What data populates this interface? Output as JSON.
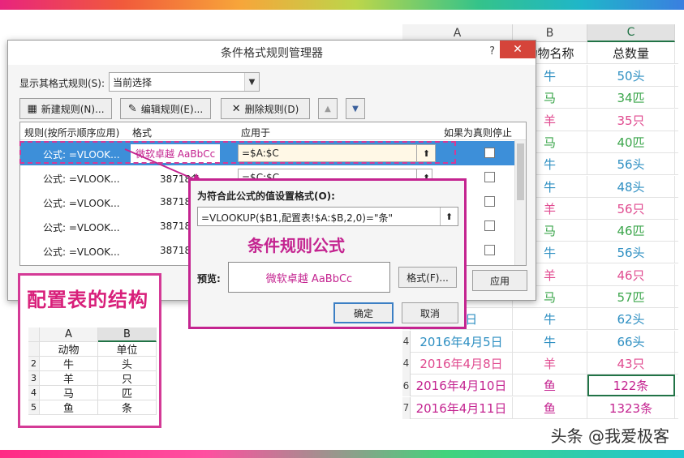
{
  "sheet": {
    "col_heads": [
      "A",
      "B",
      "C"
    ],
    "header_row": {
      "b": "动物名称",
      "c": "总数量"
    },
    "rows": [
      {
        "num": "",
        "date": "",
        "animal": "牛",
        "qty": "50头",
        "color": "#2e8fc2"
      },
      {
        "num": "",
        "date": "",
        "animal": "马",
        "qty": "34匹",
        "color": "#3aa54a"
      },
      {
        "num": "",
        "date": "",
        "animal": "羊",
        "qty": "35只",
        "color": "#e04a8f"
      },
      {
        "num": "",
        "date": "",
        "animal": "马",
        "qty": "40匹",
        "color": "#3aa54a"
      },
      {
        "num": "",
        "date": "",
        "animal": "牛",
        "qty": "56头",
        "color": "#2e8fc2"
      },
      {
        "num": "",
        "date": "",
        "animal": "牛",
        "qty": "48头",
        "color": "#2e8fc2"
      },
      {
        "num": "",
        "date": "",
        "animal": "羊",
        "qty": "56只",
        "color": "#e04a8f"
      },
      {
        "num": "",
        "date": "",
        "animal": "马",
        "qty": "46匹",
        "color": "#3aa54a"
      },
      {
        "num": "",
        "date": "",
        "animal": "牛",
        "qty": "56头",
        "color": "#2e8fc2"
      },
      {
        "num": "",
        "date": "",
        "animal": "羊",
        "qty": "46只",
        "color": "#e04a8f"
      },
      {
        "num": "",
        "date": "",
        "animal": "马",
        "qty": "57匹",
        "color": "#3aa54a"
      },
      {
        "num": "",
        "date": "月2日",
        "animal": "牛",
        "qty": "62头",
        "color": "#2e8fc2"
      },
      {
        "num": "4",
        "date": "2016年4月5日",
        "animal": "牛",
        "qty": "66头",
        "color": "#2e8fc2"
      },
      {
        "num": "4",
        "date": "2016年4月8日",
        "animal": "羊",
        "qty": "43只",
        "color": "#e04a8f"
      },
      {
        "num": "6",
        "date": "2016年4月10日",
        "animal": "鱼",
        "qty": "122条",
        "color": "#c42490"
      },
      {
        "num": "7",
        "date": "2016年4月11日",
        "animal": "鱼",
        "qty": "1323条",
        "color": "#c42490"
      }
    ]
  },
  "dialog": {
    "title": "条件格式规则管理器",
    "help": "?",
    "close": "✕",
    "show_label": "显示其格式规则(S):",
    "show_value": "当前选择",
    "new_rule": "新建规则(N)...",
    "edit_rule": "编辑规则(E)...",
    "delete_rule": "删除规则(D)",
    "up": "▲",
    "down": "▼",
    "col_rule": "规则(按所示顺序应用)",
    "col_format": "格式",
    "col_apply": "应用于",
    "col_stop": "如果为真则停止",
    "rows": [
      {
        "formula": "公式: =VLOOK...",
        "format": "微软卓越  AaBbCc",
        "apply": "=$A:$C"
      },
      {
        "formula": "公式: =VLOOK...",
        "format": "38718条",
        "apply": "=$C:$C"
      },
      {
        "formula": "公式: =VLOOK...",
        "format": "38718",
        "apply": ""
      },
      {
        "formula": "公式: =VLOOK...",
        "format": "38718",
        "apply": ""
      },
      {
        "formula": "公式: =VLOOK...",
        "format": "38718",
        "apply": ""
      }
    ],
    "apply_button": "应用"
  },
  "sub": {
    "label": "为符合此公式的值设置格式(O):",
    "formula": "=VLOOKUP($B1,配置表!$A:$B,2,0)=\"条\"",
    "caption": "条件规则公式",
    "preview_label": "预览:",
    "preview_text": "微软卓越  AaBbCc",
    "format_button": "格式(F)...",
    "ok": "确定",
    "cancel": "取消"
  },
  "config": {
    "title": "配置表的结构",
    "col_heads": [
      "A",
      "B"
    ],
    "rows": [
      {
        "num": "",
        "a": "动物",
        "b": "单位"
      },
      {
        "num": "2",
        "a": "牛",
        "b": "头"
      },
      {
        "num": "3",
        "a": "羊",
        "b": "只"
      },
      {
        "num": "4",
        "a": "马",
        "b": "匹"
      },
      {
        "num": "5",
        "a": "鱼",
        "b": "条"
      }
    ]
  },
  "watermark": "头条 @我爱极客"
}
